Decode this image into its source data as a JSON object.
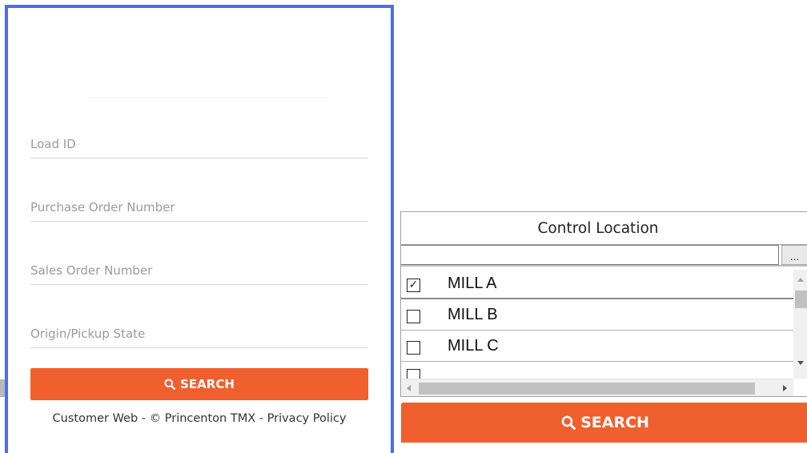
{
  "search_form": {
    "fields": [
      {
        "placeholder": "Load ID"
      },
      {
        "placeholder": "Purchase Order Number"
      },
      {
        "placeholder": "Sales Order Number"
      },
      {
        "placeholder": "Origin/Pickup State"
      }
    ],
    "search_label": "SEARCH",
    "footer": {
      "customer_web": "Customer Web",
      "separator": " - ",
      "copyright": "© Princenton TMX",
      "privacy": "Privacy Policy"
    }
  },
  "control_location": {
    "header": "Control Location",
    "filter_value": "",
    "dots_label": "...",
    "items": [
      {
        "label": "MILL A",
        "checked": true,
        "mark": "✓"
      },
      {
        "label": "MILL B",
        "checked": false,
        "mark": ""
      },
      {
        "label": "MILL C",
        "checked": false,
        "mark": ""
      }
    ],
    "search_label": "SEARCH"
  },
  "colors": {
    "accent": "#f05f2e",
    "panel_border": "#4f6de6"
  },
  "icons": {
    "search": "search-icon",
    "checkbox": "checkbox-icon"
  }
}
